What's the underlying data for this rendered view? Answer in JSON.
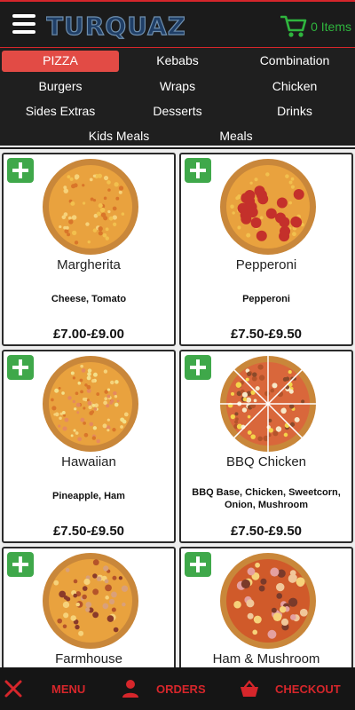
{
  "header": {
    "logo_text": "TURQUAZ",
    "cart_count": "0 Items",
    "colors": {
      "accent": "#d6262b",
      "cart": "#2fb53e",
      "logo": "#1f3e66"
    }
  },
  "categories": [
    {
      "label": "PIZZA",
      "active": true
    },
    {
      "label": "Kebabs",
      "active": false
    },
    {
      "label": "Combination",
      "active": false
    },
    {
      "label": "Burgers",
      "active": false
    },
    {
      "label": "Wraps",
      "active": false
    },
    {
      "label": "Chicken",
      "active": false
    },
    {
      "label": "Sides Extras",
      "active": false
    },
    {
      "label": "Desserts",
      "active": false
    },
    {
      "label": "Drinks",
      "active": false
    },
    {
      "label": "Kids Meals",
      "active": false
    },
    {
      "label": "Meals",
      "active": false
    }
  ],
  "products": [
    {
      "name": "Margherita",
      "description": "Cheese, Tomato",
      "price": "£7.00-£9.00",
      "topping": "plain"
    },
    {
      "name": "Pepperoni",
      "description": "Pepperoni",
      "price": "£7.50-£9.50",
      "topping": "pepperoni"
    },
    {
      "name": "Hawaiian",
      "description": "Pineapple, Ham",
      "price": "£7.50-£9.50",
      "topping": "hawaiian"
    },
    {
      "name": "BBQ Chicken",
      "description": "BBQ Base, Chicken, Sweetcorn, Onion, Mushroom",
      "price": "£7.50-£9.50",
      "topping": "bbq"
    },
    {
      "name": "Farmhouse",
      "description": "",
      "price": "",
      "topping": "farmhouse"
    },
    {
      "name": "Ham & Mushroom",
      "description": "",
      "price": "",
      "topping": "ham-mushroom"
    }
  ],
  "bottom_nav": {
    "menu": {
      "label": "MENU",
      "icon": "fork-knife-icon"
    },
    "orders": {
      "label": "ORDERS",
      "icon": "user-icon"
    },
    "checkout": {
      "label": "CHECKOUT",
      "icon": "basket-icon"
    }
  }
}
